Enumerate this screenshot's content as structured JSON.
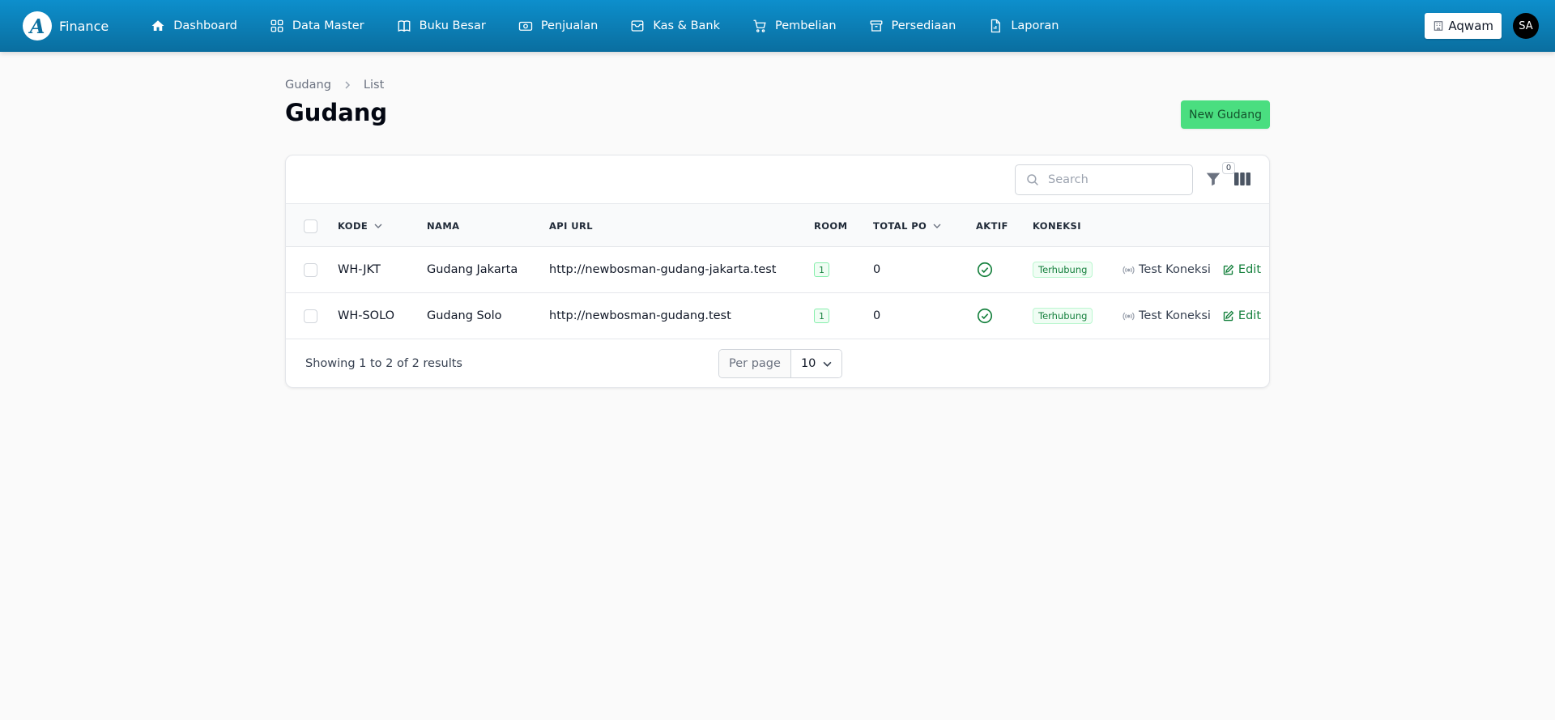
{
  "app": {
    "logo_letter": "A",
    "name": "Finance"
  },
  "nav": [
    {
      "label": "Dashboard",
      "icon": "home-icon"
    },
    {
      "label": "Data Master",
      "icon": "grid-icon"
    },
    {
      "label": "Buku Besar",
      "icon": "book-icon"
    },
    {
      "label": "Penjualan",
      "icon": "cash-icon"
    },
    {
      "label": "Kas & Bank",
      "icon": "archive-icon"
    },
    {
      "label": "Pembelian",
      "icon": "cart-icon"
    },
    {
      "label": "Persediaan",
      "icon": "box-icon"
    },
    {
      "label": "Laporan",
      "icon": "document-icon"
    }
  ],
  "user": {
    "tenant": "Aqwam",
    "initials": "SA"
  },
  "breadcrumb": [
    "Gudang",
    "List"
  ],
  "page": {
    "title": "Gudang",
    "new_button": "New Gudang"
  },
  "toolbar": {
    "search_placeholder": "Search",
    "filter_count": "0"
  },
  "table": {
    "columns": {
      "kode": "KODE",
      "nama": "NAMA",
      "api_url": "API URL",
      "room": "ROOM",
      "total_po": "TOTAL PO",
      "aktif": "AKTIF",
      "koneksi": "KONEKSI"
    },
    "rows": [
      {
        "kode": "WH-JKT",
        "nama": "Gudang Jakarta",
        "api_url": "http://newbosman-gudang-jakarta.test",
        "room": "1",
        "total_po": "0",
        "aktif": true,
        "koneksi": "Terhubung",
        "test_label": "Test Koneksi",
        "edit_label": "Edit"
      },
      {
        "kode": "WH-SOLO",
        "nama": "Gudang Solo",
        "api_url": "http://newbosman-gudang.test",
        "room": "1",
        "total_po": "0",
        "aktif": true,
        "koneksi": "Terhubung",
        "test_label": "Test Koneksi",
        "edit_label": "Edit"
      }
    ]
  },
  "footer": {
    "showing": "Showing 1 to 2 of 2 results",
    "per_page_label": "Per page",
    "per_page_value": "10"
  },
  "colors": {
    "topbar": "#0a6e9f",
    "primary_button": "#4ade80",
    "success": "#15803d"
  }
}
